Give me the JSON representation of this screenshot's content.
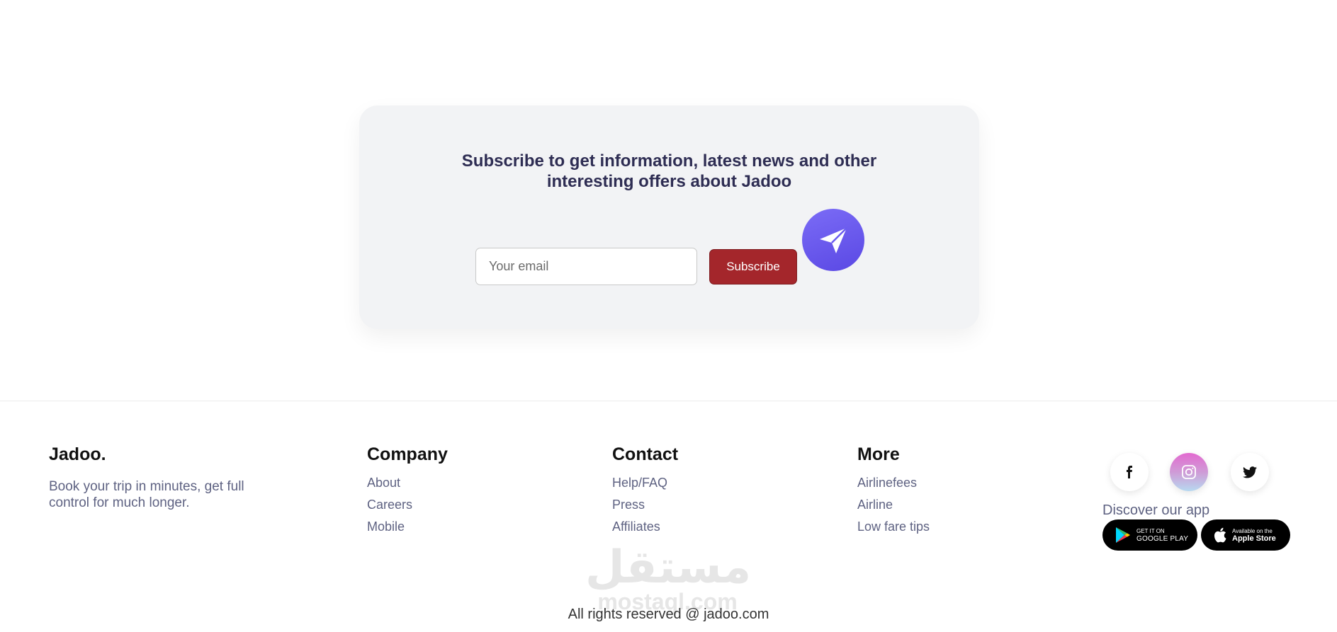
{
  "subscribe": {
    "title": "Subscribe to get information, latest news and other interesting offers about Jadoo",
    "email_placeholder": "Your email",
    "button_label": "Subscribe"
  },
  "footer": {
    "brand": "Jadoo.",
    "tagline": "Book your trip in minutes, get full control for much longer.",
    "columns": [
      {
        "heading": "Company",
        "links": [
          "About",
          "Careers",
          "Mobile"
        ]
      },
      {
        "heading": "Contact",
        "links": [
          "Help/FAQ",
          "Press",
          "Affiliates"
        ]
      },
      {
        "heading": "More",
        "links": [
          "Airlinefees",
          "Airline",
          "Low fare tips"
        ]
      }
    ],
    "social": [
      {
        "icon": "facebook-icon"
      },
      {
        "icon": "instagram-icon"
      },
      {
        "icon": "twitter-icon"
      }
    ],
    "discover_label": "Discover our app",
    "stores": {
      "google_small": "GET IT ON",
      "google_big": "GOOGLE PLAY",
      "apple_small": "Available on the",
      "apple_big": "Apple Store"
    },
    "watermark": {
      "arabic": "مستقل",
      "latin": "mostaql.com"
    },
    "copyright": "All rights reserved @ jadoo.com"
  },
  "colors": {
    "accent": "#a4262b",
    "send_badge": "#6b5cf0",
    "card_bg": "#f2f3f5",
    "heading": "#2e2d53"
  }
}
